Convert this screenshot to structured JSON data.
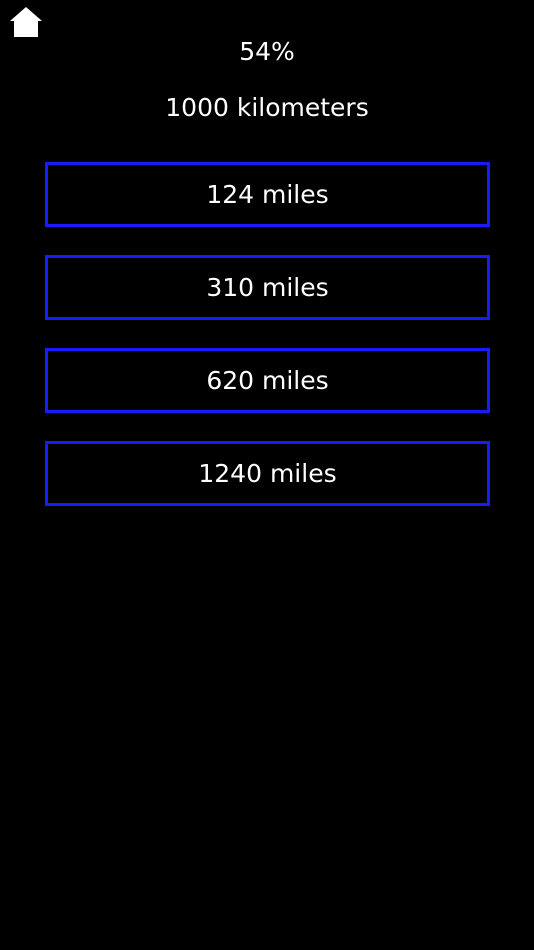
{
  "header": {
    "home_icon": "home-icon",
    "score": "54%"
  },
  "question": {
    "text": "1000 kilometers"
  },
  "answers": [
    {
      "label": "124 miles"
    },
    {
      "label": "310 miles"
    },
    {
      "label": "620 miles"
    },
    {
      "label": "1240 miles"
    }
  ],
  "colors": {
    "background": "#000000",
    "text": "#ffffff",
    "answer_border": "#1a1aff"
  }
}
